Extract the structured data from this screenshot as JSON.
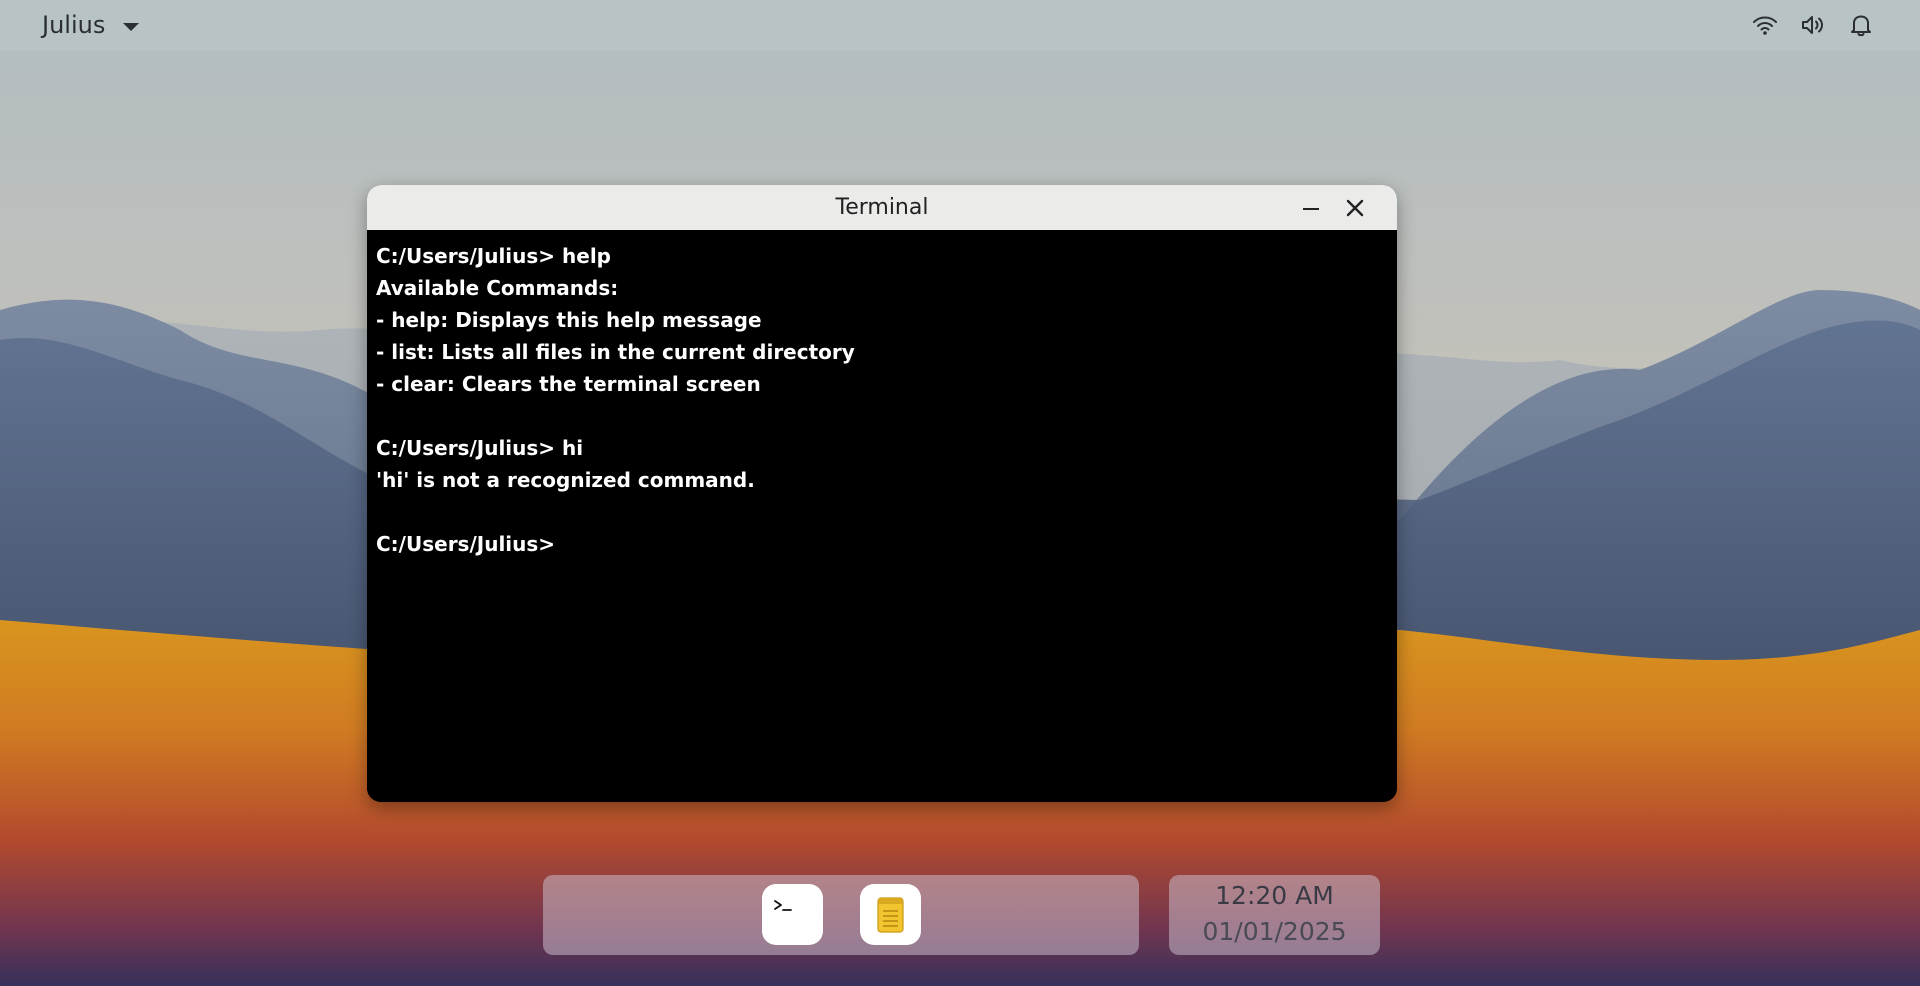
{
  "topbar": {
    "user_name": "Julius",
    "tray_icons": [
      "wifi-icon",
      "volume-icon",
      "bell-icon"
    ]
  },
  "terminal": {
    "title": "Terminal",
    "lines": [
      "C:/Users/Julius> help",
      "Available Commands:",
      "- help: Displays this help message",
      "- list: Lists all files in the current directory",
      "- clear: Clears the terminal screen",
      "",
      "C:/Users/Julius> hi",
      "'hi' is not a recognized command.",
      "",
      "C:/Users/Julius>"
    ]
  },
  "dock": {
    "apps": [
      "terminal-icon",
      "notes-icon"
    ]
  },
  "clock": {
    "time": "12:20 AM",
    "date": "01/01/2025"
  },
  "colors": {
    "terminal_bg": "#000000",
    "terminal_text": "#ffffff",
    "titlebar_bg": "#ebebea",
    "notes_icon": "#f2c530"
  }
}
